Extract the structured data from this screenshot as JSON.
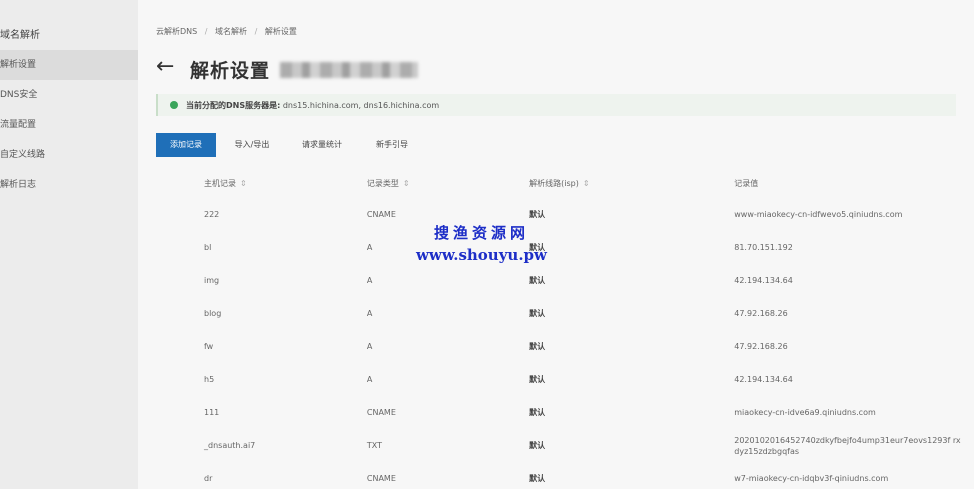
{
  "sidebar": {
    "title": "域名解析",
    "items": [
      {
        "label": "解析设置",
        "active": true
      },
      {
        "label": "DNS安全",
        "active": false
      },
      {
        "label": "流量配置",
        "active": false
      },
      {
        "label": "自定义线路",
        "active": false
      },
      {
        "label": "解析日志",
        "active": false
      }
    ]
  },
  "breadcrumb": [
    "云解析DNS",
    "/",
    "域名解析",
    "/",
    "解析设置"
  ],
  "page": {
    "title": "解析设置"
  },
  "notice": {
    "label": "当前分配的DNS服务器是:",
    "servers": "dns15.hichina.com, dns16.hichina.com"
  },
  "toolbar": {
    "add": "添加记录",
    "import": "导入/导出",
    "stats": "请求量统计",
    "guide": "新手引导"
  },
  "table": {
    "headers": {
      "host": "主机记录",
      "type": "记录类型",
      "line": "解析线路(isp)",
      "value": "记录值"
    },
    "rows": [
      {
        "host": "222",
        "type": "CNAME",
        "line": "默认",
        "value": "www-miaokecy-cn-idfwevo5.qiniudns.com"
      },
      {
        "host": "bl",
        "type": "A",
        "line": "默认",
        "value": "81.70.151.192"
      },
      {
        "host": "img",
        "type": "A",
        "line": "默认",
        "value": "42.194.134.64"
      },
      {
        "host": "blog",
        "type": "A",
        "line": "默认",
        "value": "47.92.168.26"
      },
      {
        "host": "fw",
        "type": "A",
        "line": "默认",
        "value": "47.92.168.26"
      },
      {
        "host": "h5",
        "type": "A",
        "line": "默认",
        "value": "42.194.134.64"
      },
      {
        "host": "111",
        "type": "CNAME",
        "line": "默认",
        "value": "miaokecy-cn-idve6a9.qiniudns.com"
      },
      {
        "host": "_dnsauth.ai7",
        "type": "TXT",
        "line": "默认",
        "value": "2020102016452740zdkyfbejfo4ump31eur7eovs1293f rxdyz15zdzbgqfas"
      },
      {
        "host": "dr",
        "type": "CNAME",
        "line": "默认",
        "value": "w7-miaokecy-cn-idqbv3f-qiniudns.com"
      }
    ]
  },
  "watermark": {
    "cn": "搜渔资源网",
    "url": "www.shouyu.pw"
  }
}
